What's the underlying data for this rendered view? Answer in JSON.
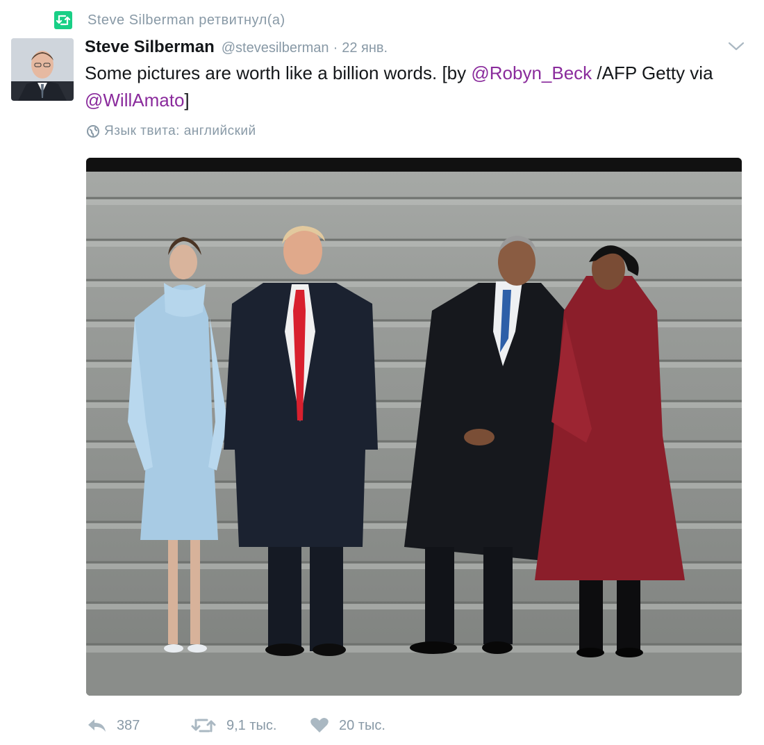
{
  "retweet_context": {
    "text": "Steve Silberman ретвитнул(а)",
    "icon": "retweet-icon"
  },
  "tweet": {
    "author_name": "Steve Silberman",
    "author_handle": "@stevesilberman",
    "separator": "·",
    "timestamp": "22 янв.",
    "text_parts": [
      "Some pictures are worth like a billion words. [by ",
      "@Robyn_Beck",
      " /AFP Getty via ",
      "@WillAmato",
      "]"
    ],
    "language_label": "Язык твита: английский",
    "menu_icon": "chevron-down-icon",
    "media_alt": "photo"
  },
  "actions": {
    "reply_count": "387",
    "retweet_count": "9,1 тыс.",
    "like_count": "20 тыс."
  },
  "colors": {
    "retweet_green": "#19cf86",
    "mention": "#8a2b9c",
    "secondary_text": "#8899a6",
    "primary_text": "#14171a"
  }
}
